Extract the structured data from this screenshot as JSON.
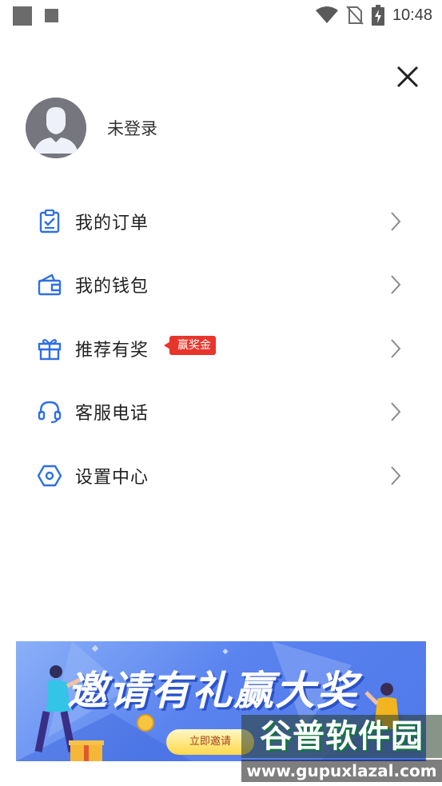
{
  "status_bar": {
    "time": "10:48",
    "icons": [
      "wifi-icon",
      "no-sim-icon",
      "battery-charging-icon"
    ]
  },
  "profile": {
    "login_status": "未登录"
  },
  "menu": {
    "items": [
      {
        "label": "我的订单",
        "icon": "order-clipboard-icon"
      },
      {
        "label": "我的钱包",
        "icon": "wallet-icon"
      },
      {
        "label": "推荐有奖",
        "icon": "gift-icon",
        "badge": "赢奖金"
      },
      {
        "label": "客服电话",
        "icon": "headset-icon"
      },
      {
        "label": "设置中心",
        "icon": "settings-hexagon-icon"
      }
    ]
  },
  "banner": {
    "title": "邀请有礼赢大奖",
    "button_label": "立即邀请"
  },
  "watermark": {
    "name": "谷普软件园",
    "url": "www.gupuxlazal.com"
  },
  "colors": {
    "accent_blue": "#2f6fe4",
    "badge_red": "#e8352c",
    "avatar_gray": "#76777e"
  }
}
